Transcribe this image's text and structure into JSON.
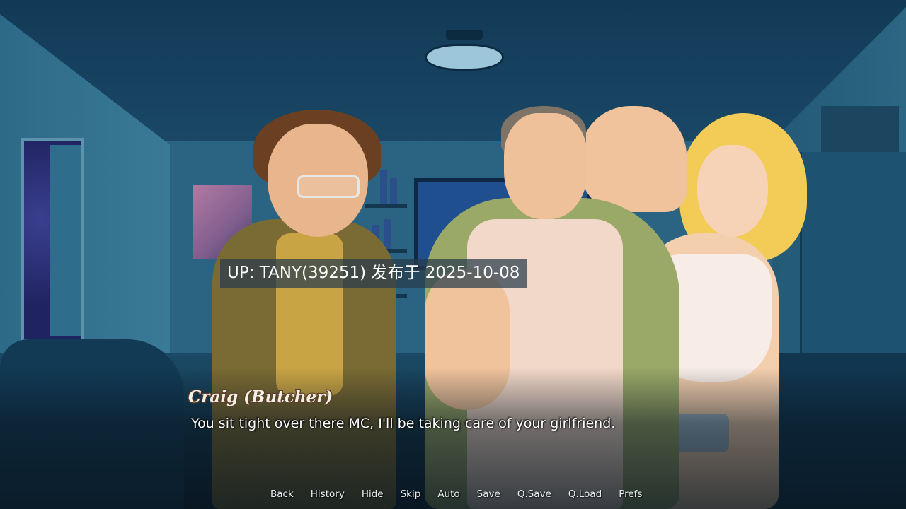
{
  "overlay": {
    "watermark": "UP: TANY(39251) 发布于 2025-10-08"
  },
  "dialogue": {
    "speaker": "Craig (Butcher)",
    "text": "You sit tight over there MC, I'll be taking care of your girlfriend."
  },
  "quick_menu": {
    "back": "Back",
    "history": "History",
    "hide": "Hide",
    "skip": "Skip",
    "auto": "Auto",
    "save": "Save",
    "qsave": "Q.Save",
    "qload": "Q.Load",
    "prefs": "Prefs"
  },
  "colors": {
    "speaker_text": "#f5f0e6",
    "speaker_outline": "#5a3d28",
    "dialogue_text": "#ffffff",
    "menu_text": "#e9eef2"
  }
}
